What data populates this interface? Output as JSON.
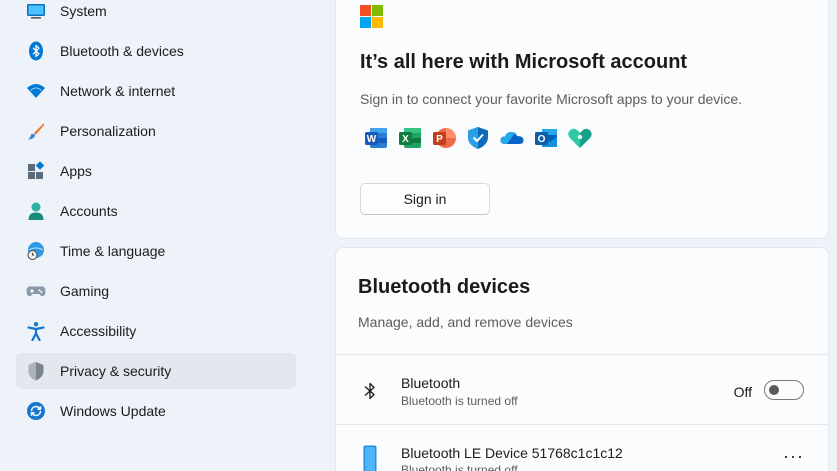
{
  "sidebar": {
    "items": [
      {
        "label": "System",
        "icon": "monitor-icon"
      },
      {
        "label": "Bluetooth & devices",
        "icon": "bluetooth-icon"
      },
      {
        "label": "Network & internet",
        "icon": "wifi-icon"
      },
      {
        "label": "Personalization",
        "icon": "brush-icon"
      },
      {
        "label": "Apps",
        "icon": "apps-icon"
      },
      {
        "label": "Accounts",
        "icon": "person-icon"
      },
      {
        "label": "Time & language",
        "icon": "globe-clock-icon"
      },
      {
        "label": "Gaming",
        "icon": "gamepad-icon"
      },
      {
        "label": "Accessibility",
        "icon": "accessibility-icon"
      },
      {
        "label": "Privacy & security",
        "icon": "shield-icon"
      },
      {
        "label": "Windows Update",
        "icon": "update-icon"
      }
    ],
    "active_index": 9
  },
  "promo": {
    "title": "It’s all here with Microsoft account",
    "subtitle": "Sign in to connect your favorite Microsoft apps to your device.",
    "apps": [
      "word-icon",
      "excel-icon",
      "powerpoint-icon",
      "defender-icon",
      "onedrive-icon",
      "outlook-icon",
      "family-icon"
    ],
    "signin_label": "Sign in"
  },
  "bluetooth": {
    "title": "Bluetooth devices",
    "subtitle": "Manage, add, and remove devices",
    "toggle_row": {
      "title": "Bluetooth",
      "subtitle": "Bluetooth is turned off",
      "state_label": "Off",
      "state": false
    },
    "device_row": {
      "title": "Bluetooth LE Device 51768c1c1c12",
      "subtitle": "Bluetooth is turned off",
      "more_label": "···"
    }
  },
  "colors": {
    "accent": "#0067c0",
    "ms_red": "#f25022",
    "ms_green": "#7fba00",
    "ms_blue": "#00a4ef",
    "ms_yellow": "#ffb900"
  }
}
